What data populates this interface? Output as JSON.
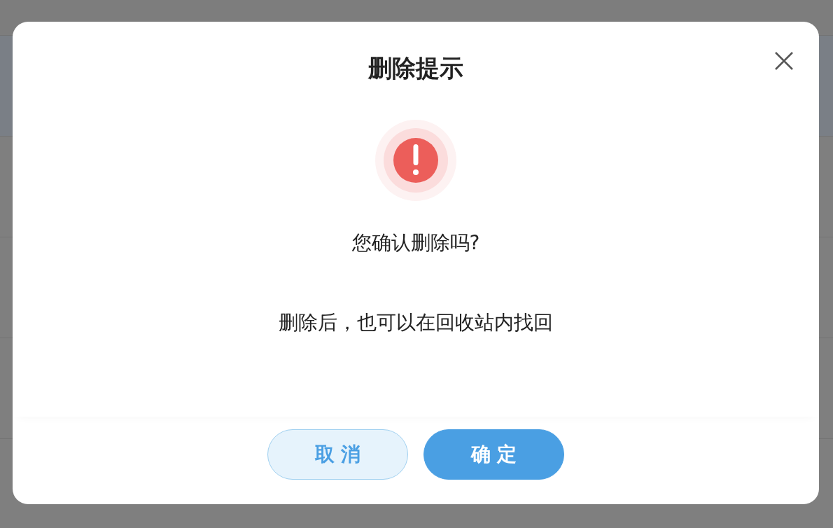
{
  "dialog": {
    "title": "删除提示",
    "message": "您确认删除吗?",
    "detail": "删除后，也可以在回收站内找回",
    "buttons": [
      {
        "label": "取 消",
        "kind": "secondary"
      },
      {
        "label": "确 定",
        "kind": "primary"
      }
    ]
  }
}
